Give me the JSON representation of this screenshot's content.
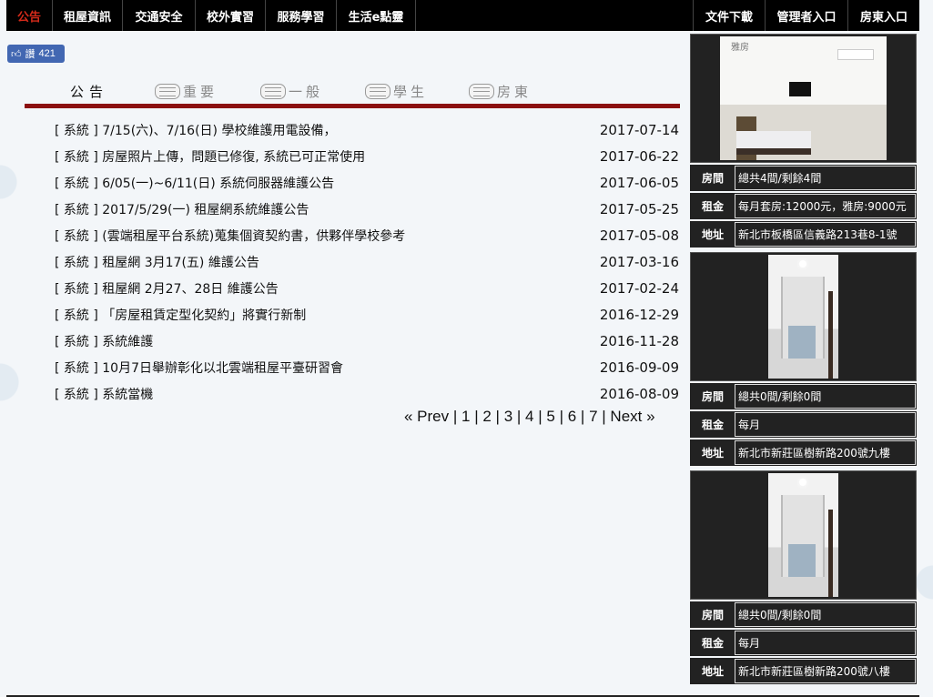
{
  "nav": {
    "left": [
      "公告",
      "租屋資訊",
      "交通安全",
      "校外實習",
      "服務學習",
      "生活e點靈"
    ],
    "right": [
      "文件下載",
      "管理者入口",
      "房東入口"
    ]
  },
  "fb": {
    "label": "讚",
    "count": "421"
  },
  "tabs": [
    "公告",
    "重要",
    "一般",
    "學生",
    "房東"
  ],
  "announcements": [
    {
      "title": "[ 系統 ] 7/15(六)、7/16(日) 學校維護用電設備，",
      "date": "2017-07-14"
    },
    {
      "title": "[ 系統 ] 房屋照片上傳，問題已修復, 系統已可正常使用",
      "date": "2017-06-22"
    },
    {
      "title": "[ 系統 ] 6/05(一)~6/11(日) 系統伺服器維護公告",
      "date": "2017-06-05"
    },
    {
      "title": "[ 系統 ] 2017/5/29(一) 租屋網系統維護公告",
      "date": "2017-05-25"
    },
    {
      "title": "[ 系統 ] (雲端租屋平台系統)蒐集個資契約書，供夥伴學校參考",
      "date": "2017-05-08"
    },
    {
      "title": "[ 系統 ] 租屋網 3月17(五) 維護公告",
      "date": "2017-03-16"
    },
    {
      "title": "[ 系統 ] 租屋網 2月27、28日 維護公告",
      "date": "2017-02-24"
    },
    {
      "title": "[ 系統 ] 「房屋租賃定型化契約」將實行新制",
      "date": "2016-12-29"
    },
    {
      "title": "[ 系統 ] 系統維護",
      "date": "2016-11-28"
    },
    {
      "title": "[ 系統 ] 10月7日舉辦彰化以北雲端租屋平臺研習會",
      "date": "2016-09-09"
    },
    {
      "title": "[ 系統 ] 系統當機",
      "date": "2016-08-09"
    }
  ],
  "pager": {
    "prev": "« Prev",
    "next": "Next »",
    "sep": " | ",
    "pages": [
      "1",
      "2",
      "3",
      "4",
      "5",
      "6",
      "7"
    ]
  },
  "listing_labels": {
    "rooms": "房間",
    "rent": "租金",
    "address": "地址"
  },
  "listings": [
    {
      "caption": "雅房",
      "rooms": "總共4間/剩餘4間",
      "rent": "每月套房:12000元，雅房:9000元",
      "address": "新北市板橋區信義路213巷8-1號"
    },
    {
      "caption": "",
      "rooms": "總共0間/剩餘0間",
      "rent": "每月",
      "address": "新北市新莊區樹新路200號九樓"
    },
    {
      "caption": "",
      "rooms": "總共0間/剩餘0間",
      "rent": "每月",
      "address": "新北市新莊區樹新路200號八樓"
    }
  ]
}
